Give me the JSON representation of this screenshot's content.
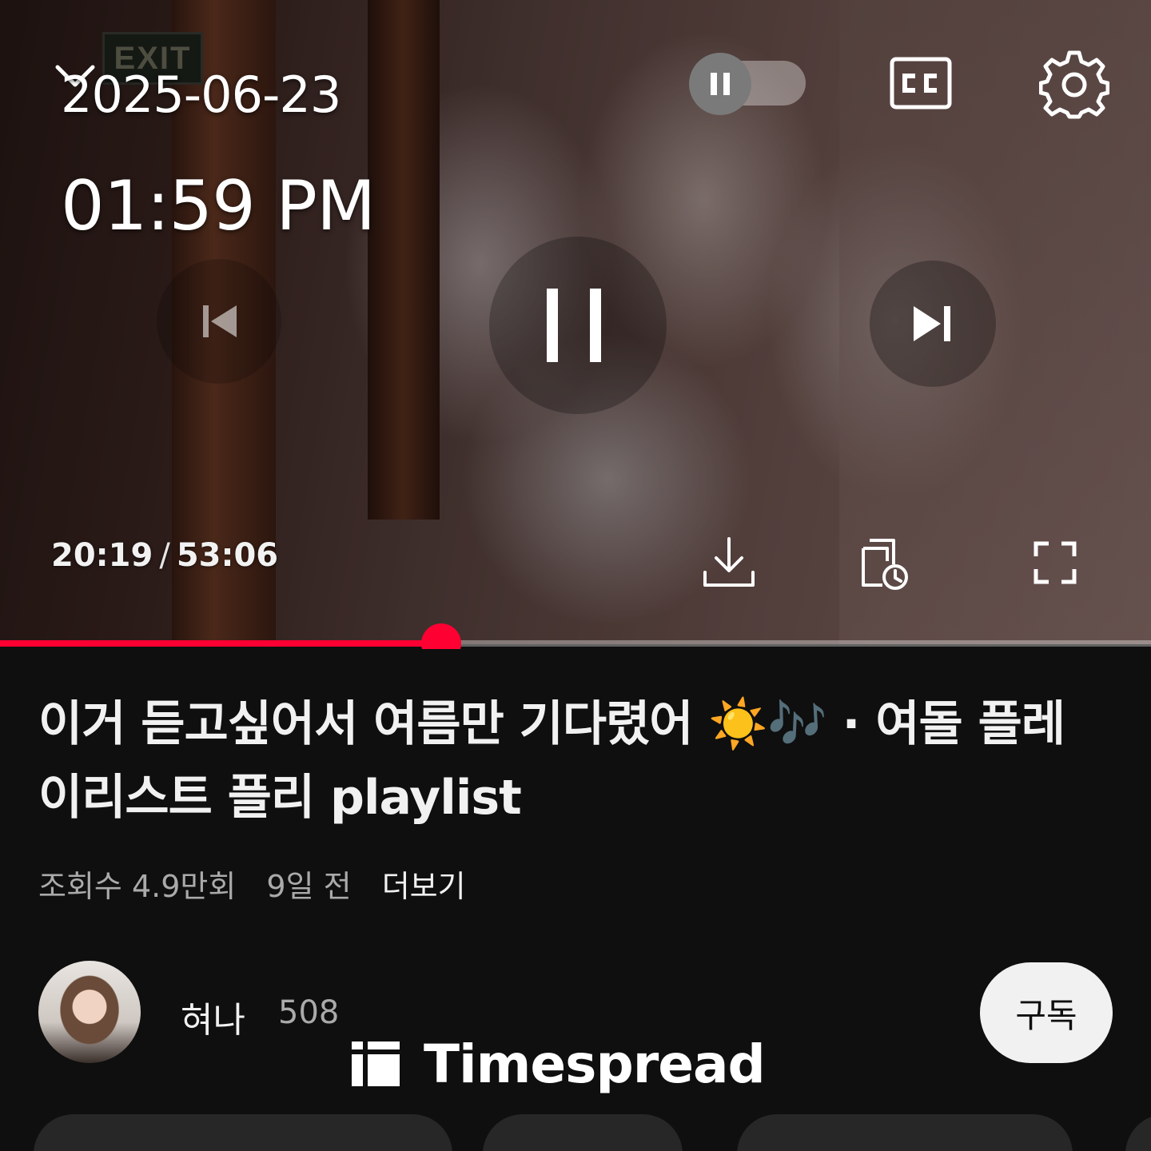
{
  "overlay": {
    "date": "2025-06-23",
    "time": "01:59 PM"
  },
  "player": {
    "current_time": "20:19",
    "separator": "/",
    "duration": "53:06",
    "progress_fraction": 0.383,
    "state": "playing",
    "icons": [
      "chevron-down-icon",
      "pause-icon",
      "closed-captions-icon",
      "gear-icon",
      "previous-icon",
      "pause-icon",
      "next-icon",
      "download-icon",
      "queue-later-icon",
      "fullscreen-icon"
    ],
    "accent_color": "#ff0033",
    "exit_sign": "EXIT"
  },
  "video": {
    "title": "이거 듣고싶어서 여름만 기다렸어 ☀️🎶 · 여돌 플레이리스트 플리 playlist",
    "views": "조회수 4.9만회",
    "uploaded": "9일 전",
    "more": "더보기"
  },
  "channel": {
    "name": "혀나",
    "subscribers": "508",
    "subscribe_label": "구독"
  },
  "watermark": {
    "text": "Timespread"
  }
}
